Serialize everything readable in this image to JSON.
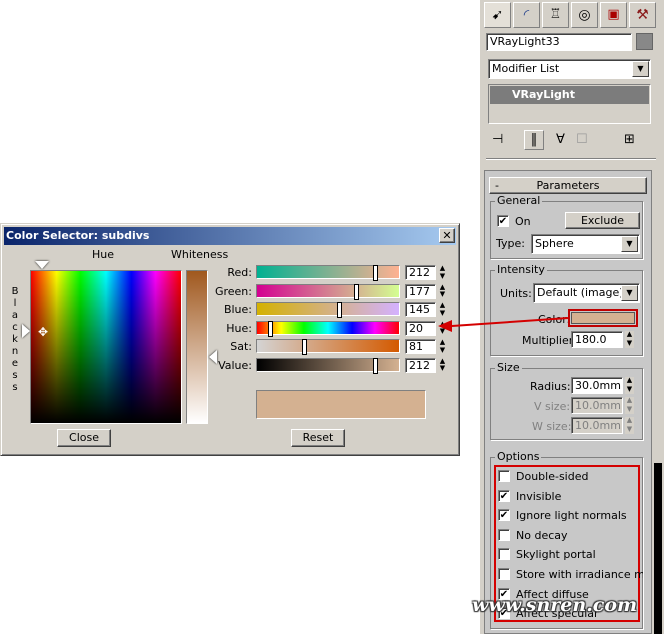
{
  "dialog": {
    "title": "Color Selector: subdivs",
    "hue_label": "Hue",
    "whiteness_label": "Whiteness",
    "blackness_letters": [
      "B",
      "l",
      "a",
      "c",
      "k",
      "n",
      "e",
      "s",
      "s"
    ],
    "close_label": "Close",
    "reset_label": "Reset",
    "channels": [
      {
        "label": "Red:",
        "value": "212",
        "fraction": 0.83
      },
      {
        "label": "Green:",
        "value": "177",
        "fraction": 0.69
      },
      {
        "label": "Blue:",
        "value": "145",
        "fraction": 0.57
      },
      {
        "label": "Hue:",
        "value": "20",
        "fraction": 0.08
      },
      {
        "label": "Sat:",
        "value": "81",
        "fraction": 0.32
      },
      {
        "label": "Value:",
        "value": "212",
        "fraction": 0.83
      }
    ],
    "swatch_color": "#d4b191"
  },
  "panel": {
    "tab_icons": [
      "create-icon",
      "modify-icon",
      "hierarchy-icon",
      "motion-icon",
      "display-icon",
      "utilities-icon"
    ],
    "object_name": "VRayLight33",
    "modifier_list_label": "Modifier List",
    "stack_item": "VRayLight",
    "rollout_toggle": "-",
    "rollout_title": "Parameters",
    "general": {
      "title": "General",
      "on_label": "On",
      "exclude_label": "Exclude",
      "type_label": "Type:",
      "type_value": "Sphere"
    },
    "intensity": {
      "title": "Intensity",
      "units_label": "Units:",
      "units_value": "Default (image)",
      "color_label": "Color:",
      "color_value": "#d4b191",
      "multiplier_label": "Multiplier:",
      "multiplier_value": "180.0"
    },
    "size": {
      "title": "Size",
      "radius_label": "Radius:",
      "radius_value": "30.0mm",
      "vsize_label": "V size:",
      "vsize_value": "10.0mm",
      "wsize_label": "W size:",
      "wsize_value": "10.0mm"
    },
    "options": {
      "title": "Options",
      "items": [
        {
          "label": "Double-sided",
          "checked": false
        },
        {
          "label": "Invisible",
          "checked": true
        },
        {
          "label": "Ignore light normals",
          "checked": true
        },
        {
          "label": "No decay",
          "checked": false
        },
        {
          "label": "Skylight portal",
          "checked": false
        },
        {
          "label": "Store with irradiance map",
          "checked": false
        },
        {
          "label": "Affect diffuse",
          "checked": true
        },
        {
          "label": "Affect specular",
          "checked": true
        }
      ]
    }
  },
  "watermark": "www.snren.com",
  "highlight_color": "#d40000"
}
